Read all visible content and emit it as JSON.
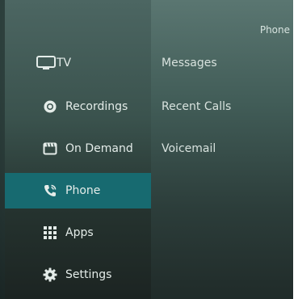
{
  "header": {
    "title": "Phone"
  },
  "sidebar": {
    "items": [
      {
        "label": "TV",
        "icon": "tv-icon"
      },
      {
        "label": "Recordings",
        "icon": "record-icon"
      },
      {
        "label": "On Demand",
        "icon": "on-demand-icon"
      },
      {
        "label": "Phone",
        "icon": "phone-icon",
        "active": true
      },
      {
        "label": "Apps",
        "icon": "apps-grid-icon"
      },
      {
        "label": "Settings",
        "icon": "gear-icon"
      }
    ]
  },
  "submenu": {
    "items": [
      {
        "label": "Messages"
      },
      {
        "label": "Recent Calls"
      },
      {
        "label": "Voicemail"
      }
    ]
  },
  "colors": {
    "active_highlight": "#176a70",
    "text": "#e4ece9"
  }
}
